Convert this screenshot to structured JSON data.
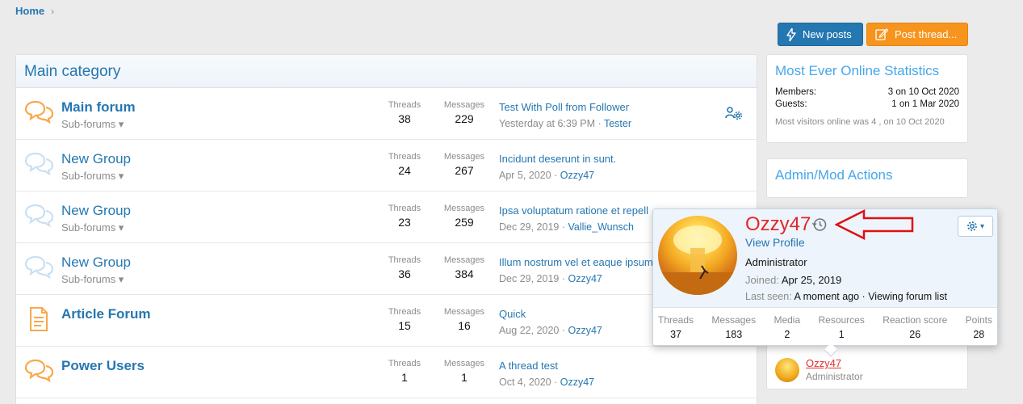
{
  "breadcrumb": {
    "home": "Home"
  },
  "buttons": {
    "new_posts": "New posts",
    "post_thread": "Post thread..."
  },
  "category": {
    "title": "Main category"
  },
  "nodes": [
    {
      "title": "Main forum",
      "sub": "Sub-forums ▾",
      "threads_label": "Threads",
      "threads": "38",
      "messages_label": "Messages",
      "messages": "229",
      "last_title": "Test With Poll from Follower",
      "last_date": "Yesterday at 6:39 PM",
      "last_user": "Tester",
      "icon": "chat-bubbles-icon",
      "color": "#f7a94a"
    },
    {
      "title": "New Group",
      "sub": "Sub-forums ▾",
      "threads_label": "Threads",
      "threads": "24",
      "messages_label": "Messages",
      "messages": "267",
      "last_title": "Incidunt deserunt in sunt.",
      "last_date": "Apr 5, 2020",
      "last_user": "Ozzy47",
      "icon": "chat-bubbles-icon",
      "color": "#c9e0f3"
    },
    {
      "title": "New Group",
      "sub": "Sub-forums ▾",
      "threads_label": "Threads",
      "threads": "23",
      "messages_label": "Messages",
      "messages": "259",
      "last_title": "Ipsa voluptatum ratione et repell",
      "last_date": "Dec 29, 2019",
      "last_user": "Vallie_Wunsch",
      "icon": "chat-bubbles-icon",
      "color": "#c9e0f3"
    },
    {
      "title": "New Group",
      "sub": "Sub-forums ▾",
      "threads_label": "Threads",
      "threads": "36",
      "messages_label": "Messages",
      "messages": "384",
      "last_title": "Illum nostrum vel et eaque ipsum",
      "last_date": "Dec 29, 2019",
      "last_user": "Ozzy47",
      "icon": "chat-bubbles-icon",
      "color": "#c9e0f3"
    },
    {
      "title": "Article Forum",
      "sub": "",
      "threads_label": "Threads",
      "threads": "15",
      "messages_label": "Messages",
      "messages": "16",
      "last_title": "Quick",
      "last_date": "Aug 22, 2020",
      "last_user": "Ozzy47",
      "icon": "document-icon",
      "color": "#f7a94a"
    },
    {
      "title": "Power Users",
      "sub": "",
      "threads_label": "Threads",
      "threads": "1",
      "messages_label": "Messages",
      "messages": "1",
      "last_title": "A thread test",
      "last_date": "Oct 4, 2020",
      "last_user": "Ozzy47",
      "icon": "chat-bubbles-icon",
      "color": "#f7a94a"
    }
  ],
  "sidebar": {
    "online_title": "Most Ever Online Statistics",
    "members_label": "Members:",
    "members_value": "3 on 10 Oct 2020",
    "guests_label": "Guests:",
    "guests_value": "1 on 1 Mar 2020",
    "note": "Most visitors online was 4 , on 10 Oct 2020",
    "admin_title": "Admin/Mod Actions",
    "staff_name": "Ozzy47",
    "staff_role": "Administrator"
  },
  "tooltip": {
    "name": "Ozzy47",
    "view_profile": "View Profile",
    "role": "Administrator",
    "joined_label": "Joined:",
    "joined_value": "Apr 25, 2019",
    "seen_label": "Last seen:",
    "seen_value": "A moment ago · Viewing forum list",
    "gear_caret": "▾",
    "stats": [
      {
        "label": "Threads",
        "value": "37"
      },
      {
        "label": "Messages",
        "value": "183"
      },
      {
        "label": "Media",
        "value": "2"
      },
      {
        "label": "Resources",
        "value": "1"
      },
      {
        "label": "Reaction score",
        "value": "26"
      },
      {
        "label": "Points",
        "value": "28"
      }
    ]
  },
  "colors": {
    "accent": "#2577b1",
    "orange": "#f7941d",
    "username": "#e02828",
    "arrow": "#e01010"
  }
}
